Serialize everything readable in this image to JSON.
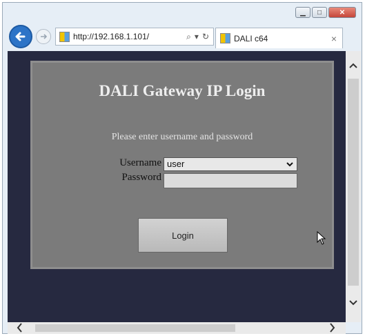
{
  "browser": {
    "address_url": "http://192.168.1.101/",
    "tab_title": "DALI c64",
    "tab_close": "×"
  },
  "page": {
    "title": "DALI Gateway IP Login",
    "prompt": "Please enter username and password",
    "username_label": "Username",
    "username_value": "user",
    "password_label": "Password",
    "password_value": "",
    "login_label": "Login"
  },
  "colors": {
    "page_background": "#262940",
    "panel_background": "#7b7b7b",
    "back_button": "#2d74c7"
  }
}
